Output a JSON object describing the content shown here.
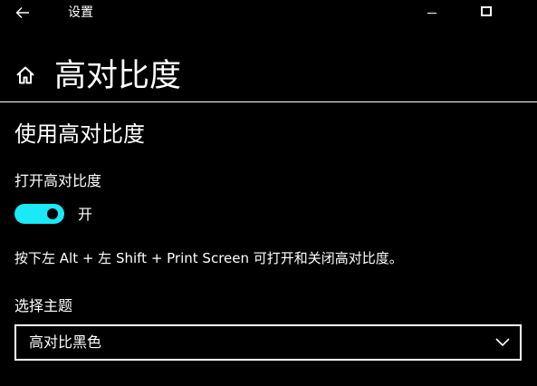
{
  "titlebar": {
    "app_title": "设置",
    "back_icon": "back-arrow-icon",
    "minimize_icon": "minimize-icon",
    "maximize_icon": "maximize-icon"
  },
  "header": {
    "home_icon": "home-icon",
    "title": "高对比度"
  },
  "section": {
    "title": "使用高对比度"
  },
  "toggle": {
    "label": "打开高对比度",
    "state_text": "开",
    "is_on": true,
    "accent_color": "#1ae9f6"
  },
  "help_text": "按下左 Alt + 左 Shift + Print Screen 可打开和关闭高对比度。",
  "theme": {
    "label": "选择主题",
    "selected_value": "高对比黑色",
    "dropdown_icon": "chevron-down-icon"
  },
  "colors": {
    "background": "#000000",
    "foreground": "#ffffff",
    "accent": "#1ae9f6"
  }
}
